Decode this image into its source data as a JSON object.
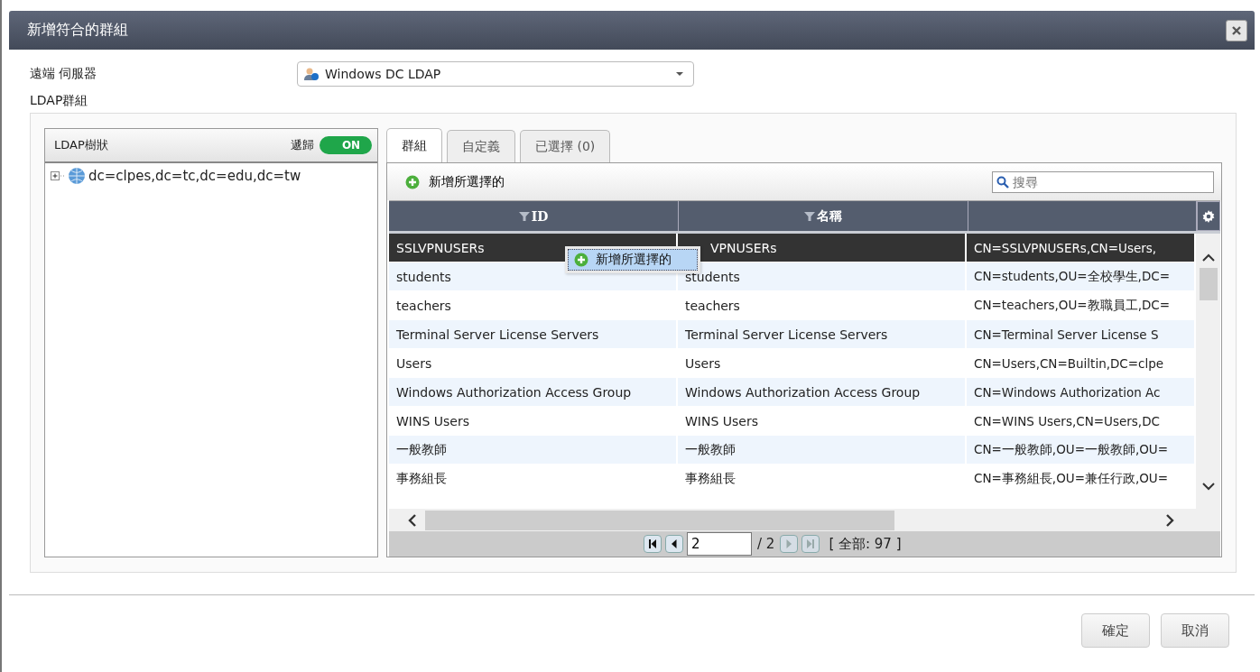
{
  "dialog": {
    "title": "新增符合的群組"
  },
  "server": {
    "label": "遠端 伺服器",
    "value": "Windows DC LDAP"
  },
  "group_label": "LDAP群組",
  "tree_panel": {
    "title": "LDAP樹狀",
    "recursive": {
      "label": "遞歸",
      "on": true,
      "text": "ON"
    },
    "nodes": [
      {
        "label": "dc=clpes,dc=tc,dc=edu,dc=tw",
        "expanded": false
      }
    ]
  },
  "tabs": [
    {
      "label": "群組",
      "selected": true
    },
    {
      "label": "自定義",
      "selected": false
    },
    {
      "label": "已選擇 (0)",
      "selected": false
    }
  ],
  "toolbar": {
    "add_button": "新增所選擇的",
    "search_placeholder": "搜尋"
  },
  "table": {
    "columns": [
      "ID",
      "名稱"
    ],
    "rows": [
      {
        "cells": [
          "SSLVPNUSERs",
          "VPNUSERs",
          "CN=SSLVPNUSERs,CN=Users,"
        ],
        "selected": true
      },
      {
        "cells": [
          "students",
          "students",
          "CN=students,OU=全校學生,DC="
        ],
        "selected": false
      },
      {
        "cells": [
          "teachers",
          "teachers",
          "CN=teachers,OU=教職員工,DC="
        ],
        "selected": false
      },
      {
        "cells": [
          "Terminal Server License Servers",
          "Terminal Server License Servers",
          "CN=Terminal Server License S"
        ],
        "selected": false
      },
      {
        "cells": [
          "Users",
          "Users",
          "CN=Users,CN=Builtin,DC=clpe"
        ],
        "selected": false
      },
      {
        "cells": [
          "Windows Authorization Access Group",
          "Windows Authorization Access Group",
          "CN=Windows Authorization Ac"
        ],
        "selected": false
      },
      {
        "cells": [
          "WINS Users",
          "WINS Users",
          "CN=WINS Users,CN=Users,DC"
        ],
        "selected": false
      },
      {
        "cells": [
          "一般教師",
          "一般教師",
          "CN=一般教師,OU=一般教師,OU="
        ],
        "selected": false
      },
      {
        "cells": [
          "事務組長",
          "事務組長",
          "CN=事務組長,OU=兼任行政,OU="
        ],
        "selected": false
      }
    ]
  },
  "context_menu": {
    "item": "新增所選擇的"
  },
  "pager": {
    "page": "2",
    "total_pages": "/ 2",
    "total": "[ 全部: 97 ]",
    "buttons": [
      {
        "kind": "first",
        "disabled": false
      },
      {
        "kind": "prev",
        "disabled": false
      },
      {
        "kind": "next",
        "disabled": true
      },
      {
        "kind": "last",
        "disabled": true
      }
    ]
  },
  "buttons": [
    "確定",
    "取消"
  ]
}
